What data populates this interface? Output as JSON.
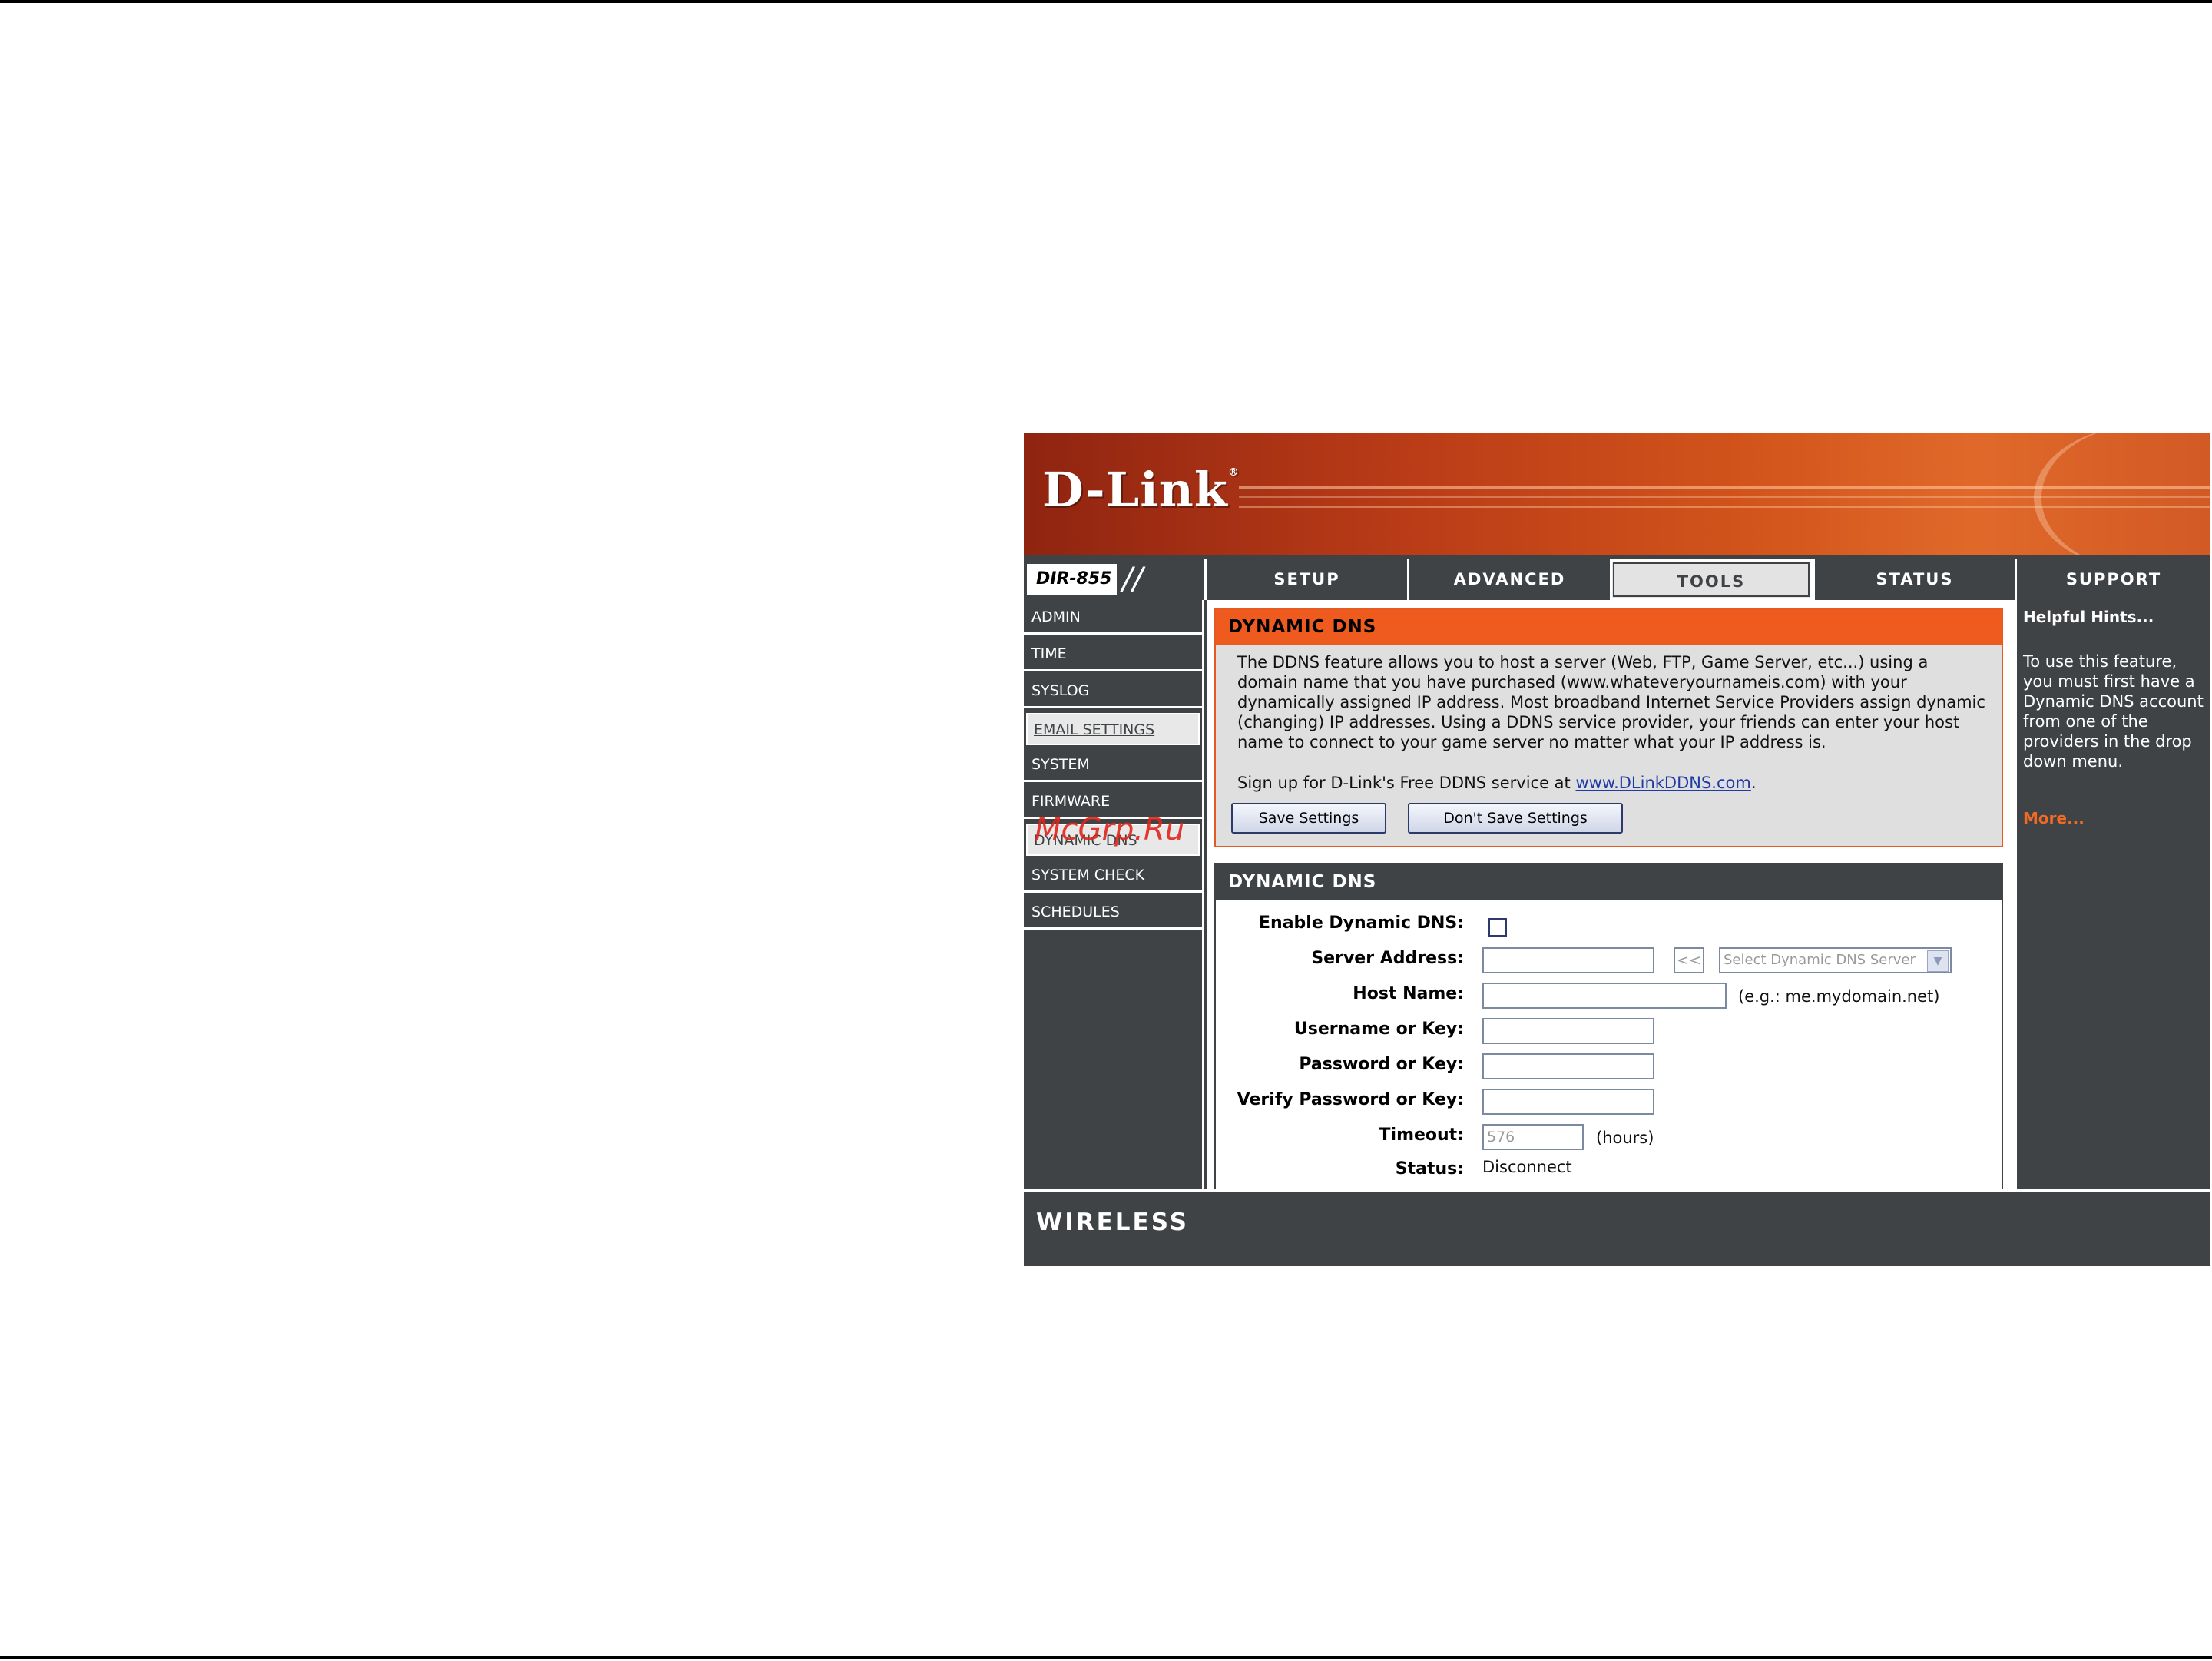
{
  "brand": {
    "logo": "D-Link",
    "model": "DIR-855"
  },
  "tabs": [
    {
      "label": "SETUP"
    },
    {
      "label": "ADVANCED"
    },
    {
      "label": "TOOLS"
    },
    {
      "label": "STATUS"
    },
    {
      "label": "SUPPORT"
    }
  ],
  "nav": [
    {
      "label": "ADMIN"
    },
    {
      "label": "TIME"
    },
    {
      "label": "SYSLOG"
    },
    {
      "label": "EMAIL SETTINGS"
    },
    {
      "label": "SYSTEM"
    },
    {
      "label": "FIRMWARE"
    },
    {
      "label": "DYNAMIC DNS"
    },
    {
      "label": "SYSTEM CHECK"
    },
    {
      "label": "SCHEDULES"
    }
  ],
  "intro": {
    "title": "DYNAMIC DNS",
    "description": "The DDNS feature allows you to host a server (Web, FTP, Game Server, etc...) using a domain name that you have purchased (www.whateveryournameis.com) with your dynamically assigned IP address. Most broadband Internet Service Providers assign dynamic (changing) IP addresses. Using a DDNS service provider, your friends can enter your host name to connect to your game server no matter what your IP address is.",
    "signup_prefix": "Sign up for D-Link's Free DDNS service at ",
    "signup_link": "www.DLinkDDNS.com",
    "signup_suffix": ".",
    "save_button": "Save Settings",
    "dont_save_button": "Don't Save Settings"
  },
  "form": {
    "title": "DYNAMIC DNS",
    "enable_label": "Enable Dynamic DNS:",
    "server_label": "Server Address:",
    "server_copy_button": "<<",
    "server_select": "Select Dynamic DNS Server",
    "host_label": "Host Name:",
    "host_hint": "(e.g.: me.mydomain.net)",
    "username_label": "Username or Key:",
    "password_label": "Password or Key:",
    "verify_label": "Verify Password or Key:",
    "timeout_label": "Timeout:",
    "timeout_value": "576",
    "timeout_unit": "(hours)",
    "status_label": "Status:",
    "status_value": "Disconnect"
  },
  "hints": {
    "title": "Helpful Hints...",
    "body": "To use this feature, you must first have a Dynamic DNS account from one of the providers in the drop down menu.",
    "more": "More..."
  },
  "footer": {
    "label": "WIRELESS"
  },
  "watermark": "McGrp.Ru"
}
